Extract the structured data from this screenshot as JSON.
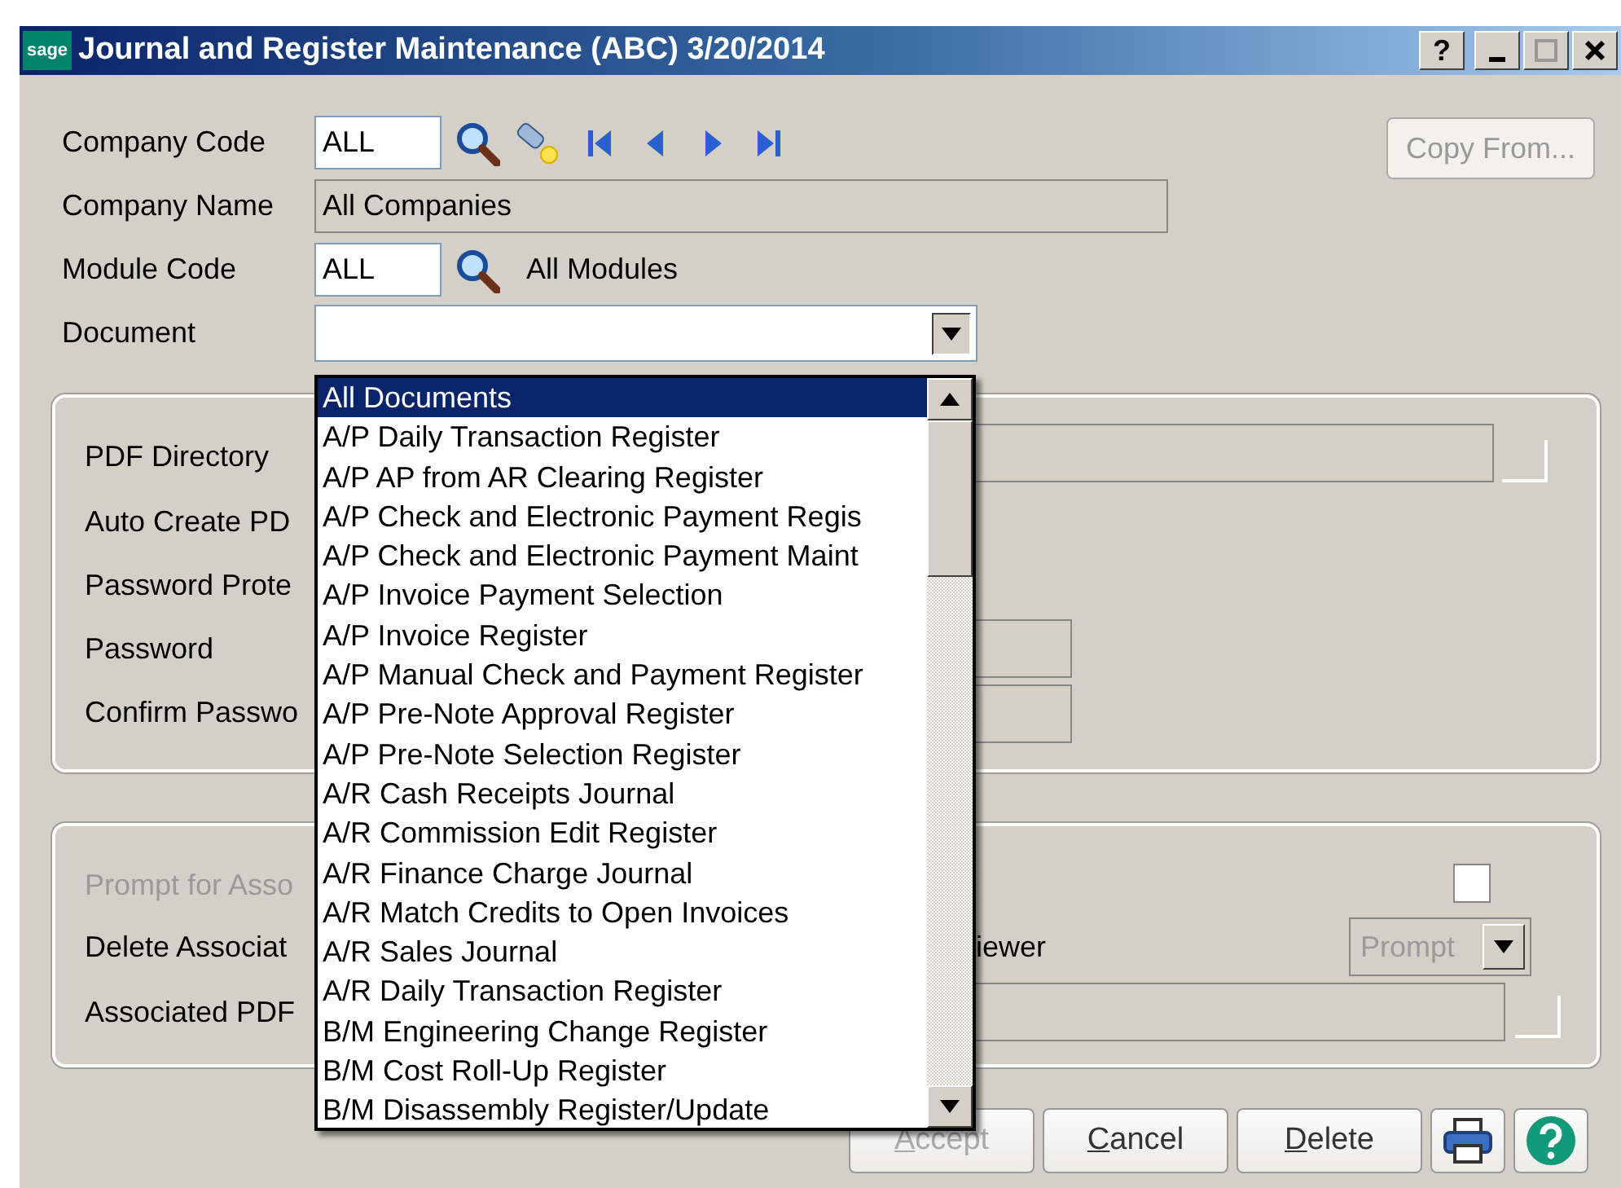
{
  "window": {
    "logo": "sage",
    "title": "Journal and Register Maintenance (ABC) 3/20/2014",
    "help_glyph": "?"
  },
  "header": {
    "company_code": {
      "label": "Company Code",
      "value": "ALL"
    },
    "company_name": {
      "label": "Company Name",
      "value": "All Companies"
    },
    "module_code": {
      "label": "Module Code",
      "value": "ALL",
      "description": "All Modules"
    },
    "document": {
      "label": "Document",
      "expanded": true
    },
    "copy_from_button": {
      "label": "Copy From...",
      "disabled": true
    }
  },
  "document_list": [
    {
      "label": "All Documents",
      "selected": true
    },
    {
      "label": "A/P Daily Transaction Register",
      "selected": false
    },
    {
      "label": "A/P AP from AR Clearing Register",
      "selected": false
    },
    {
      "label": "A/P Check and Electronic Payment Regis",
      "selected": false
    },
    {
      "label": "A/P Check and Electronic Payment Maint",
      "selected": false
    },
    {
      "label": "A/P Invoice Payment Selection",
      "selected": false
    },
    {
      "label": "A/P Invoice Register",
      "selected": false
    },
    {
      "label": "A/P Manual Check and Payment Register",
      "selected": false
    },
    {
      "label": "A/P Pre-Note Approval Register",
      "selected": false
    },
    {
      "label": "A/P Pre-Note Selection Register",
      "selected": false
    },
    {
      "label": "A/R Cash Receipts Journal",
      "selected": false
    },
    {
      "label": "A/R Commission Edit Register",
      "selected": false
    },
    {
      "label": "A/R Finance Charge Journal",
      "selected": false
    },
    {
      "label": "A/R Match Credits to Open Invoices",
      "selected": false
    },
    {
      "label": "A/R Sales Journal",
      "selected": false
    },
    {
      "label": "A/R Daily Transaction Register",
      "selected": false
    },
    {
      "label": "B/M Engineering Change Register",
      "selected": false
    },
    {
      "label": "B/M Cost Roll-Up Register",
      "selected": false
    },
    {
      "label": "B/M Disassembly Register/Update",
      "selected": false
    }
  ],
  "pdf_group": {
    "pdf_directory_label": "PDF Directory",
    "auto_create_label": "Auto Create PD",
    "password_protect_label": "Password Prote",
    "password_label": "Password",
    "confirm_password_label": "Confirm Passwo"
  },
  "associated_group": {
    "prompt_label": {
      "text": "Prompt for Asso",
      "disabled": true
    },
    "prompt_checkbox": {
      "checked": false
    },
    "delete_label": "Delete Associat",
    "viewer_label": "iewer",
    "viewer_option": {
      "value": "Prompt",
      "disabled": true
    },
    "associated_pdf_label": "Associated PDF"
  },
  "buttons": [
    {
      "kind": "text",
      "label": "Accept",
      "disabled": true
    },
    {
      "kind": "text",
      "label": "Cancel",
      "disabled": false
    },
    {
      "kind": "text",
      "label": "Delete",
      "disabled": false
    },
    {
      "kind": "print"
    },
    {
      "kind": "help"
    }
  ]
}
